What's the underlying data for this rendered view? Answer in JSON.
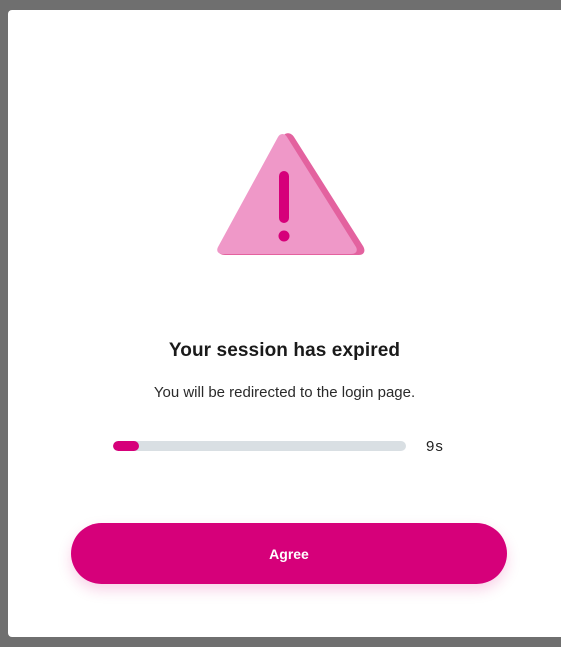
{
  "dialog": {
    "title": "Your session has expired",
    "message": "You will be redirected to the login page.",
    "countdown": "9s",
    "progress_fraction": 0.09,
    "agree_label": "Agree",
    "icon": "warning-triangle-icon"
  },
  "colors": {
    "accent": "#d6007a",
    "icon_light": "#ef98c8",
    "track": "#d9dfe3"
  }
}
